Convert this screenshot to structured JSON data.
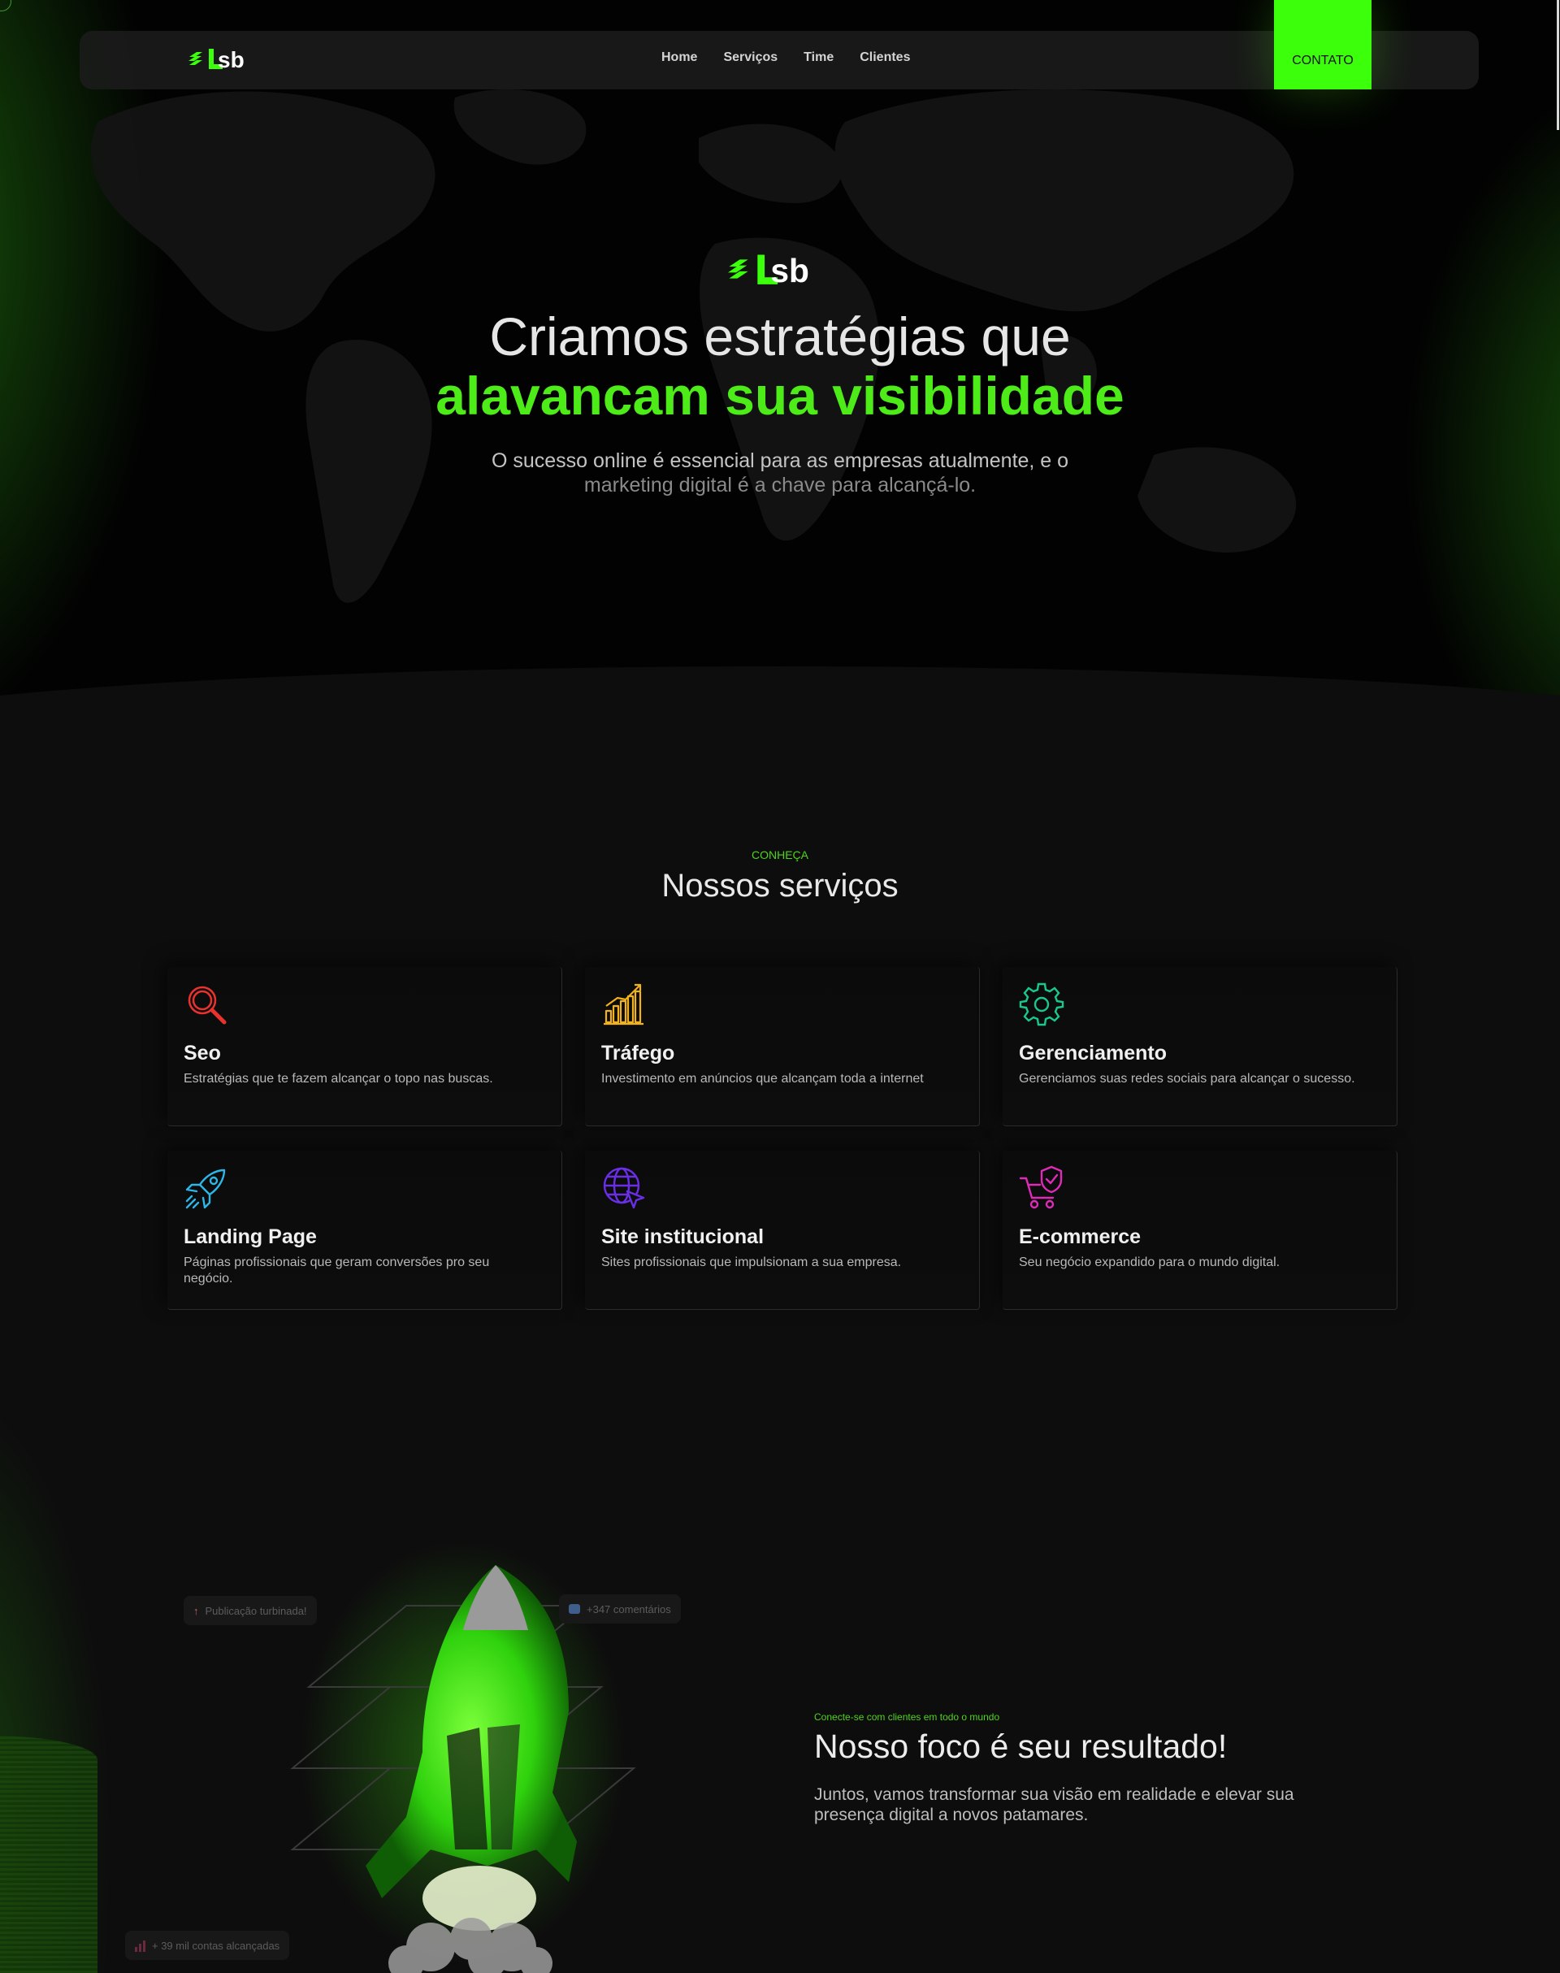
{
  "brand": {
    "name": "LSB",
    "accent": "#3bff0b",
    "accent_text": "#4dec19"
  },
  "nav": {
    "links": [
      "Home",
      "Serviços",
      "Time",
      "Clientes"
    ],
    "cta": "CONTATO"
  },
  "hero": {
    "title_line1": "Criamos estratégias que",
    "title_line2": "alavancam sua visibilidade",
    "subtitle_line1": "O sucesso online é essencial para as empresas atualmente, e o",
    "subtitle_line2": "marketing digital é a chave para alcançá-lo."
  },
  "services": {
    "eyebrow": "CONHEÇA",
    "title": "Nossos serviços",
    "items": [
      {
        "icon": "search-icon",
        "color": "#e8322f",
        "title": "Seo",
        "desc": "Estratégias que te fazem alcançar o topo nas buscas."
      },
      {
        "icon": "bar-chart-icon",
        "color": "#f2b21b",
        "title": "Tráfego",
        "desc": "Investimento em anúncios que alcançam toda a internet"
      },
      {
        "icon": "gear-icon",
        "color": "#19c98c",
        "title": "Gerenciamento",
        "desc": "Gerenciamos suas redes sociais para alcançar o sucesso."
      },
      {
        "icon": "rocket-icon",
        "color": "#2cb7e8",
        "title": "Landing Page",
        "desc": "Páginas profissionais que geram conversões pro seu negócio."
      },
      {
        "icon": "globe-cursor-icon",
        "color": "#6a2ee8",
        "title": "Site institucional",
        "desc": "Sites profissionais que impulsionam a sua empresa."
      },
      {
        "icon": "cart-shield-icon",
        "color": "#e02ab8",
        "title": "E-commerce",
        "desc": "Seu negócio expandido para o mundo digital."
      }
    ]
  },
  "focus": {
    "eyebrow": "Conecte-se com clientes em todo o mundo",
    "title": "Nosso foco é seu resultado!",
    "desc": "Juntos, vamos transformar sua visão em realidade e elevar sua presença digital a novos patamares.",
    "chips": {
      "publication": "Publicação turbinada!",
      "comments": "+347 comentários",
      "reach": "+ 39 mil contas alcançadas"
    }
  }
}
